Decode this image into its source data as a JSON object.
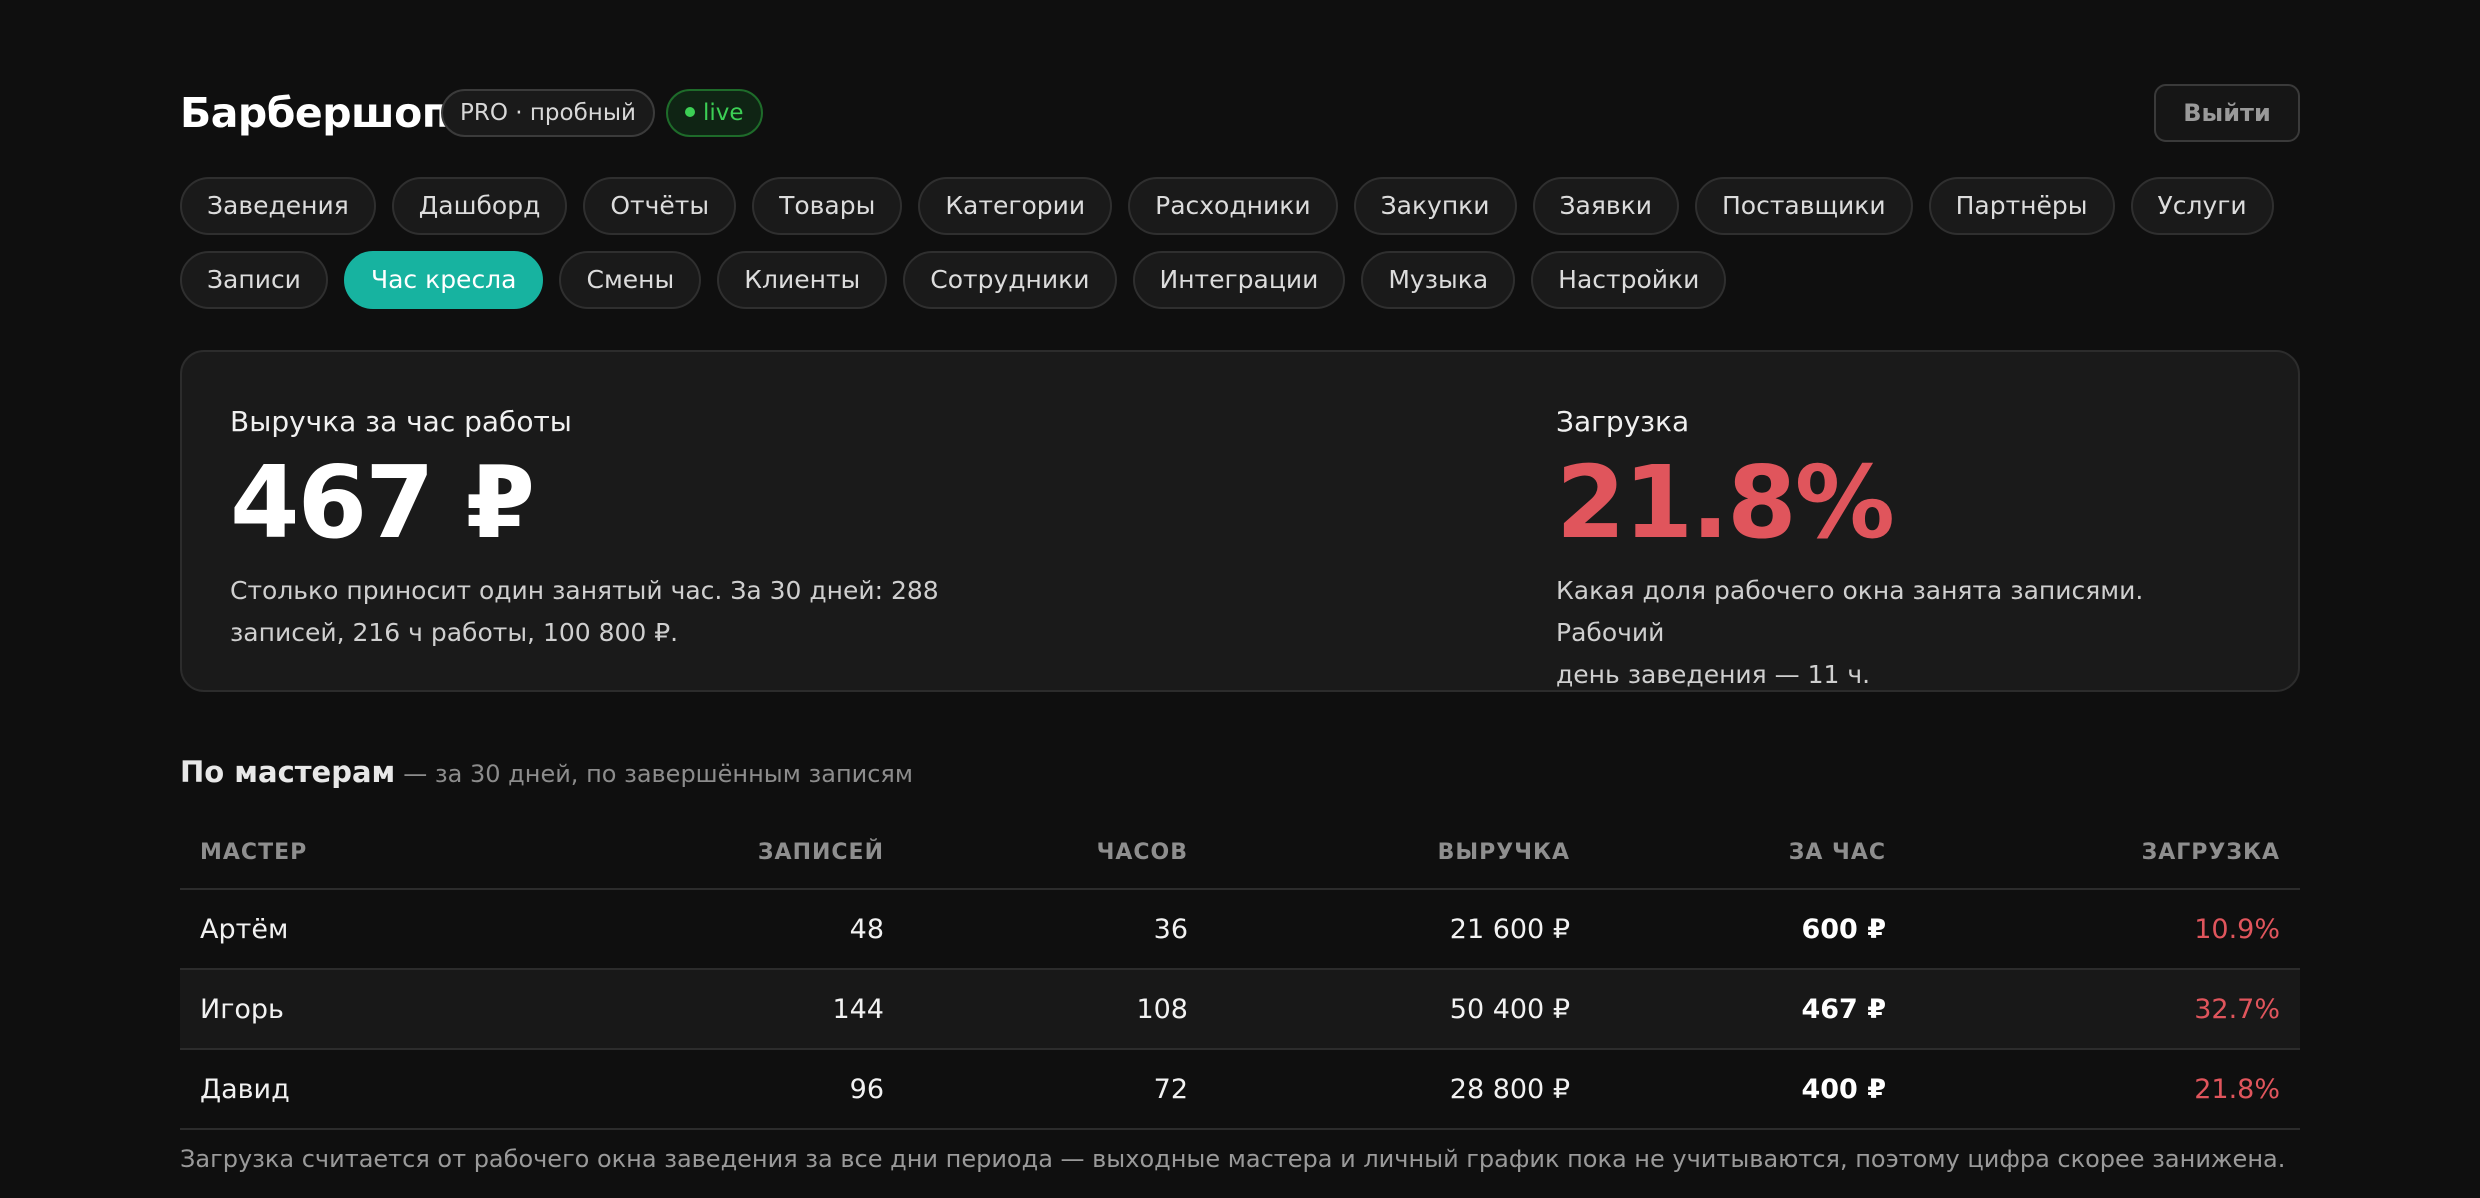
{
  "header": {
    "title": "Барбершоп",
    "plan_badge": "PRO · пробный",
    "live_badge": "live",
    "logout_label": "Выйти"
  },
  "nav": {
    "row1": [
      "Заведения",
      "Дашборд",
      "Отчёты",
      "Товары",
      "Категории",
      "Расходники",
      "Закупки",
      "Заявки",
      "Поставщики",
      "Партнёры",
      "Услуги"
    ],
    "row2": [
      "Записи",
      "Час кресла",
      "Смены",
      "Клиенты",
      "Сотрудники",
      "Интеграции",
      "Музыка",
      "Настройки"
    ],
    "active": "Час кресла"
  },
  "summary": {
    "revenue_label": "Выручка за час работы",
    "revenue_value": "467 ₽",
    "revenue_desc_line1": "Столько приносит один занятый час. За 30 дней: 288",
    "revenue_desc_line2": "записей, 216 ч работы, 100 800 ₽.",
    "load_label": "Загрузка",
    "load_value": "21.8%",
    "load_desc_line1": "Какая доля рабочего окна занята записями. Рабочий",
    "load_desc_line2": "день заведения — 11 ч."
  },
  "masters": {
    "title": "По мастерам",
    "subtitle": "— за 30 дней, по завершённым записям",
    "columns": {
      "master": "МАСТЕР",
      "records": "ЗАПИСЕЙ",
      "hours": "ЧАСОВ",
      "revenue": "ВЫРУЧКА",
      "per_hour": "ЗА ЧАС",
      "load": "ЗАГРУЗКА"
    },
    "rows": [
      {
        "name": "Артём",
        "records": "48",
        "hours": "36",
        "revenue": "21 600 ₽",
        "per_hour": "600 ₽",
        "load": "10.9%"
      },
      {
        "name": "Игорь",
        "records": "144",
        "hours": "108",
        "revenue": "50 400 ₽",
        "per_hour": "467 ₽",
        "load": "32.7%"
      },
      {
        "name": "Давид",
        "records": "96",
        "hours": "72",
        "revenue": "28 800 ₽",
        "per_hour": "400 ₽",
        "load": "21.8%"
      }
    ]
  },
  "footnote": "Загрузка считается от рабочего окна заведения за все дни периода — выходные мастера и личный график пока не учитываются, поэтому цифра скорее занижена.",
  "colors": {
    "accent": "#17b3a0",
    "danger": "#e0555c",
    "live": "#3ccf55"
  }
}
